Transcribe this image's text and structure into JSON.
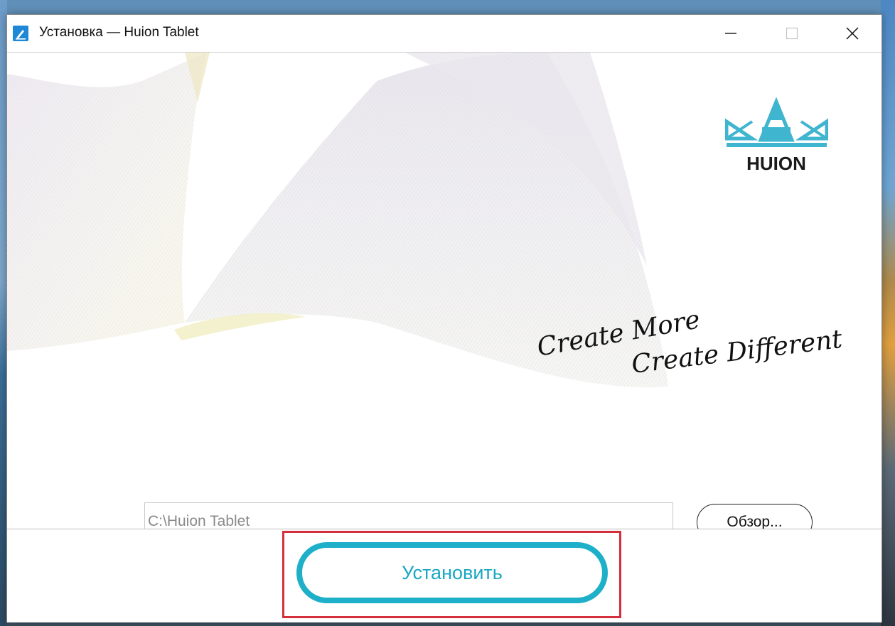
{
  "window": {
    "title": "Установка — Huion Tablet",
    "controls": {
      "minimize": "minimize-icon",
      "maximize": "maximize-icon",
      "close": "close-icon"
    }
  },
  "branding": {
    "logo_text": "HUION",
    "tagline_line1": "Create More",
    "tagline_line2": "Create Different"
  },
  "install_path": {
    "value": "C:\\Huion Tablet",
    "browse_label": "Обзор..."
  },
  "footer": {
    "install_label": "Установить",
    "highlight_color": "#d32f3c"
  },
  "colors": {
    "accent": "#1fb0c9",
    "logo_blue": "#3fb5cf",
    "logo_text": "#1a1a1a"
  }
}
